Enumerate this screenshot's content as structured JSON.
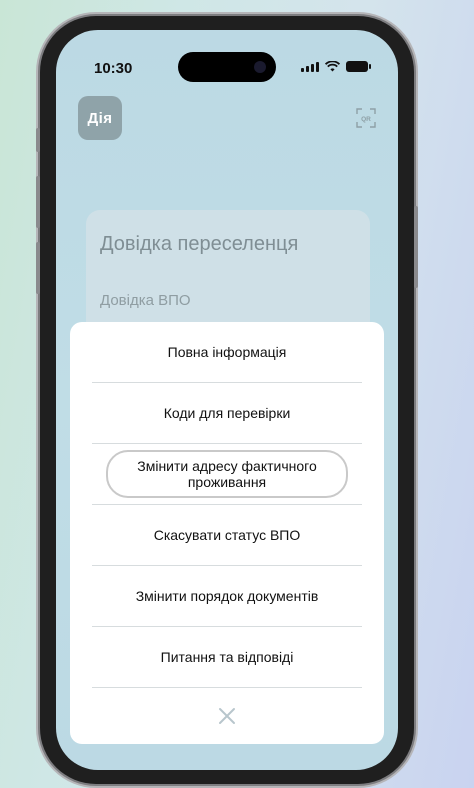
{
  "status_bar": {
    "time": "10:30"
  },
  "app": {
    "logo_text": "Дія",
    "qr_icon": "qr-scan-icon"
  },
  "document_card": {
    "title": "Довідка переселенця",
    "subtitle": "Довідка ВПО"
  },
  "menu": {
    "items": [
      {
        "label": "Повна інформація"
      },
      {
        "label": "Коди для перевірки"
      },
      {
        "label": "Змінити адресу фактичного проживання",
        "highlighted": true
      },
      {
        "label": "Скасувати статус ВПО"
      },
      {
        "label": "Змінити порядок документів"
      },
      {
        "label": "Питання та відповіді"
      }
    ],
    "close_icon": "close-icon"
  },
  "colors": {
    "screen_bg": "#bcd9e4",
    "sheet_bg": "#ffffff",
    "divider": "#d7dcde",
    "pill_border": "#c9c9c9",
    "close_icon": "#b8c6cc"
  }
}
